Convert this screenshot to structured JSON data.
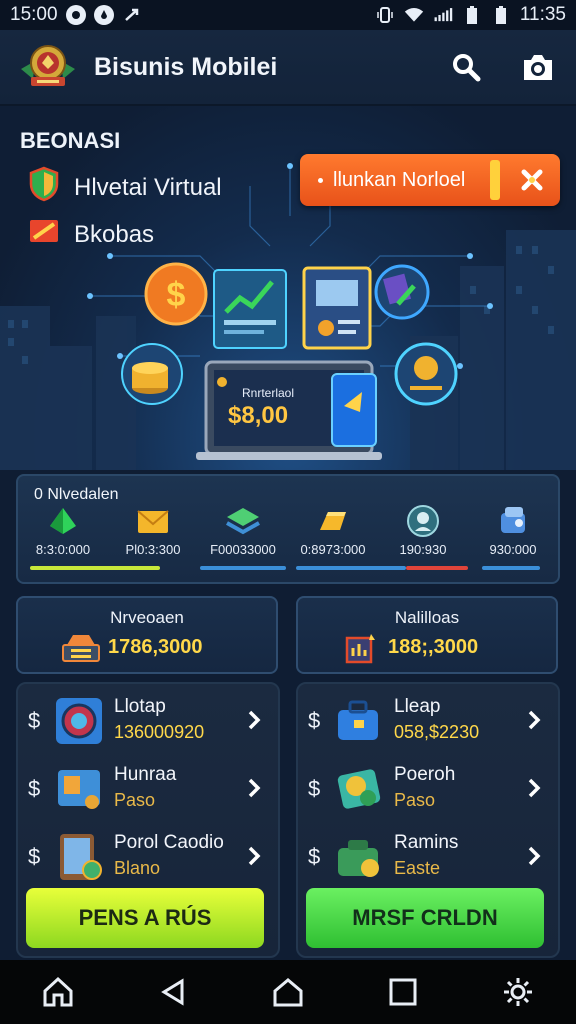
{
  "status_bar": {
    "time_left": "15:00",
    "time_right": "11:35"
  },
  "header": {
    "app_title": "Bisunis Mobilei",
    "icons": [
      "logo-emblem",
      "search-icon",
      "camera-icon"
    ]
  },
  "hero": {
    "section_title": "BEONASI",
    "features": [
      {
        "label": "Hlvetai Virtual",
        "icon": "shield-icon"
      },
      {
        "label": "Bkobas",
        "icon": "flag-icon"
      }
    ],
    "promo_button": "llunkan Norloel",
    "device_label": "Rnrterlaol",
    "device_price": "$8,00"
  },
  "overview": {
    "title": "0 Nlvedalen",
    "items": [
      {
        "icon": "gem-icon",
        "value": "8:3:0:000"
      },
      {
        "icon": "envelope-icon",
        "value": "Pl0:3:300"
      },
      {
        "icon": "stack-icon",
        "value": "F00033000"
      },
      {
        "icon": "gold-bar-icon",
        "value": "0:8973:000"
      },
      {
        "icon": "medal-icon",
        "value": "190:930"
      },
      {
        "icon": "cube-icon",
        "value": "930:000"
      }
    ],
    "bar_colors": [
      "#c8e83a",
      "#3b8fd8",
      "#e0443a",
      "#3b8fd8"
    ]
  },
  "stats": [
    {
      "label": "Nrveoaen",
      "value": "1786,3000",
      "icon": "cash-register-icon"
    },
    {
      "label": "Nalilloas",
      "value": "188;,3000",
      "icon": "chart-board-icon"
    }
  ],
  "panels": [
    {
      "rows": [
        {
          "title": "Llotap",
          "subtitle": "136000920",
          "icon": "dial-icon"
        },
        {
          "title": "Hunraa",
          "subtitle": "Paso",
          "icon": "card-chart-icon"
        },
        {
          "title": "Porol Caodio",
          "subtitle": "Blano",
          "icon": "tablet-icon"
        }
      ],
      "button": "PENS A RÚS"
    },
    {
      "rows": [
        {
          "title": "Lleap",
          "subtitle": "058,$2230",
          "icon": "briefcase-icon"
        },
        {
          "title": "Poeroh",
          "subtitle": "Paso",
          "icon": "coin-card-icon"
        },
        {
          "title": "Ramins",
          "subtitle": "Easte",
          "icon": "money-bag-icon"
        }
      ],
      "button": "MRSF CRLDN"
    }
  ],
  "nav": [
    "home-outline-icon",
    "back-icon",
    "home-icon",
    "recents-icon",
    "settings-icon"
  ]
}
